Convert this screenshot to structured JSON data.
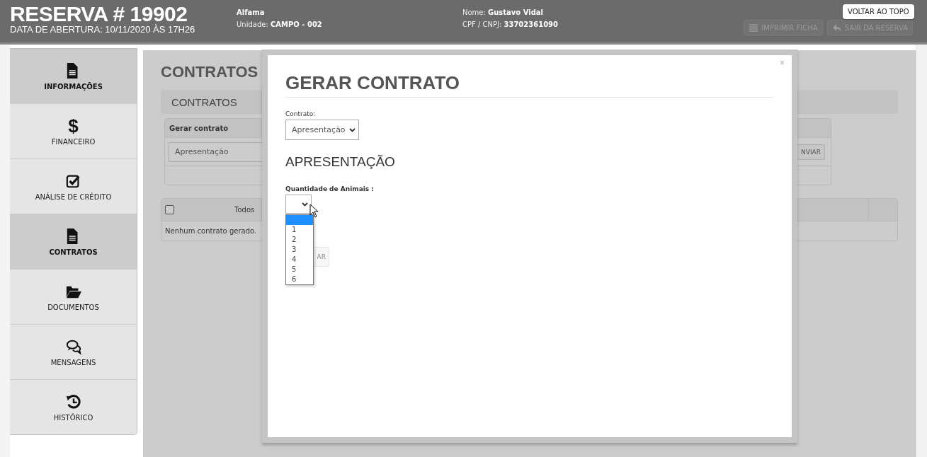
{
  "header": {
    "title": "RESERVA # 19902",
    "subtitle": "DATA DE ABERTURA: 10/11/2020 ÀS 17H26",
    "info": [
      {
        "lines": [
          {
            "value": "Alfama"
          },
          {
            "label": "Unidade:",
            "value": "CAMPO - 002"
          }
        ]
      },
      {
        "lines": [
          {
            "label": "Nome:",
            "value": "Gustavo Vidal"
          },
          {
            "label": "CPF / CNPJ:",
            "value": "33702361090"
          }
        ]
      }
    ],
    "buttons": [
      {
        "label": "IMPRIMIR FICHA",
        "kind": "list"
      },
      {
        "label": "SAIR DA RESERVA",
        "kind": "reply"
      }
    ],
    "top_button": "VOLTAR AO TOPO"
  },
  "sidebar": {
    "items": [
      {
        "label": "INFORMAÇÕES",
        "kind": "file",
        "selected": true
      },
      {
        "label": "FINANCEIRO",
        "kind": "glyph",
        "glyph": "$",
        "selected": false
      },
      {
        "label": "ANÁLISE DE CRÉDITO",
        "kind": "checkbox",
        "selected": false
      },
      {
        "label": "CONTRATOS",
        "kind": "file",
        "selected": true
      },
      {
        "label": "DOCUMENTOS",
        "kind": "folder",
        "selected": false
      },
      {
        "label": "MENSAGENS",
        "kind": "comments",
        "selected": false
      },
      {
        "label": "HISTÓRICO",
        "kind": "history",
        "selected": false
      }
    ]
  },
  "content": {
    "title": "CONTRATOS",
    "panel_title": "CONTRATOS",
    "generate_table": {
      "header": "Gerar contrato",
      "select_value": "Apresentação",
      "send_button": "NVIAR"
    },
    "list_table": {
      "checked": false,
      "header": "Todos",
      "empty": "Nenhum contrato gerado."
    }
  },
  "modal": {
    "close": "×",
    "title": "GERAR CONTRATO",
    "contract_label": "Contrato:",
    "contract_value": "Apresentação",
    "section": "APRESENTAÇÃO",
    "quantity_label": "Quantidade de Animais :",
    "blank_option": {
      "selected": true
    },
    "options": [
      {
        "label": "1",
        "selected": false
      },
      {
        "label": "2",
        "selected": false
      },
      {
        "label": "3",
        "selected": false
      },
      {
        "label": "4",
        "selected": false
      },
      {
        "label": "5",
        "selected": false
      },
      {
        "label": "6",
        "selected": false
      }
    ],
    "button": "AR"
  }
}
